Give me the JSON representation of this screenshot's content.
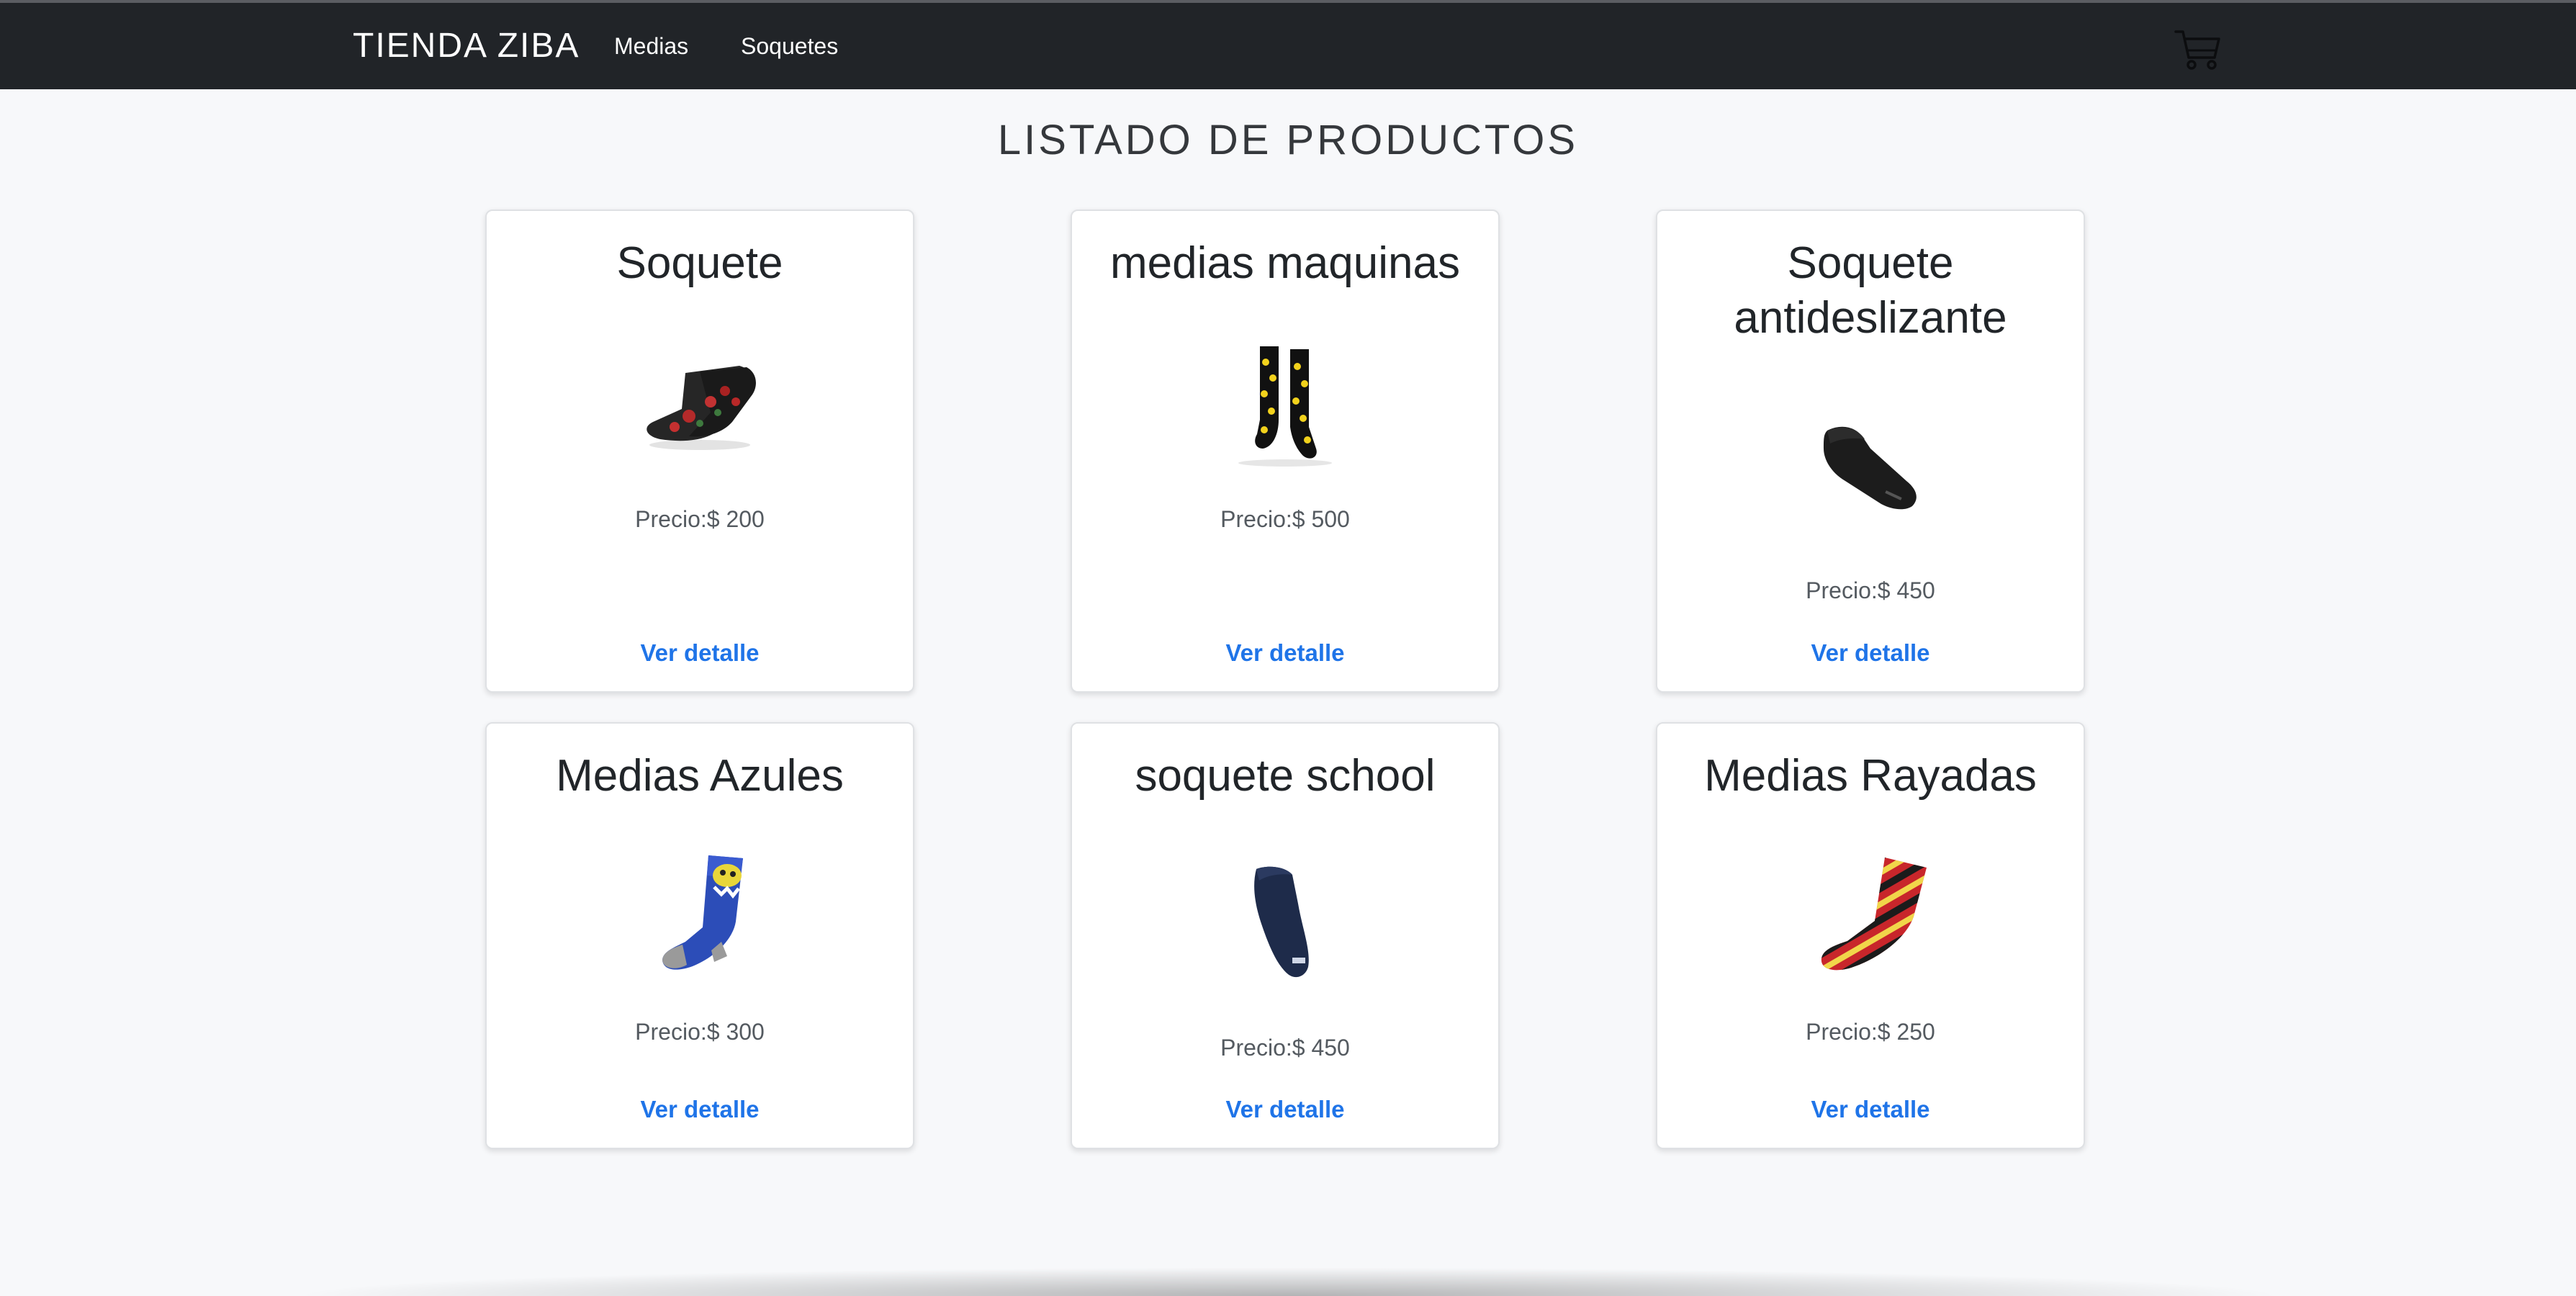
{
  "navbar": {
    "brand": "TIENDA ZIBA",
    "links": [
      "Medias",
      "Soquetes"
    ],
    "cart_icon": "cart-icon"
  },
  "page_title": "LISTADO DE PRODUCTOS",
  "products": [
    {
      "title": "Soquete",
      "price": "Precio:$ 200",
      "link": "Ver detalle",
      "image": "black-floral-ankle-sock"
    },
    {
      "title": "medias maquinas",
      "price": "Precio:$ 500",
      "link": "Ver detalle",
      "image": "black-smiley-crew-socks"
    },
    {
      "title": "Soquete antideslizante",
      "price": "Precio:$ 450",
      "link": "Ver detalle",
      "image": "black-no-show-sock"
    },
    {
      "title": "Medias Azules",
      "price": "Precio:$ 300",
      "link": "Ver detalle",
      "image": "blue-character-sock"
    },
    {
      "title": "soquete school",
      "price": "Precio:$ 450",
      "link": "Ver detalle",
      "image": "navy-ankle-sock"
    },
    {
      "title": "Medias Rayadas",
      "price": "Precio:$ 250",
      "link": "Ver detalle",
      "image": "red-striped-sock"
    }
  ],
  "colors": {
    "navbar": "#212428",
    "link": "#1f74e8",
    "background": "#f7f8fa"
  }
}
